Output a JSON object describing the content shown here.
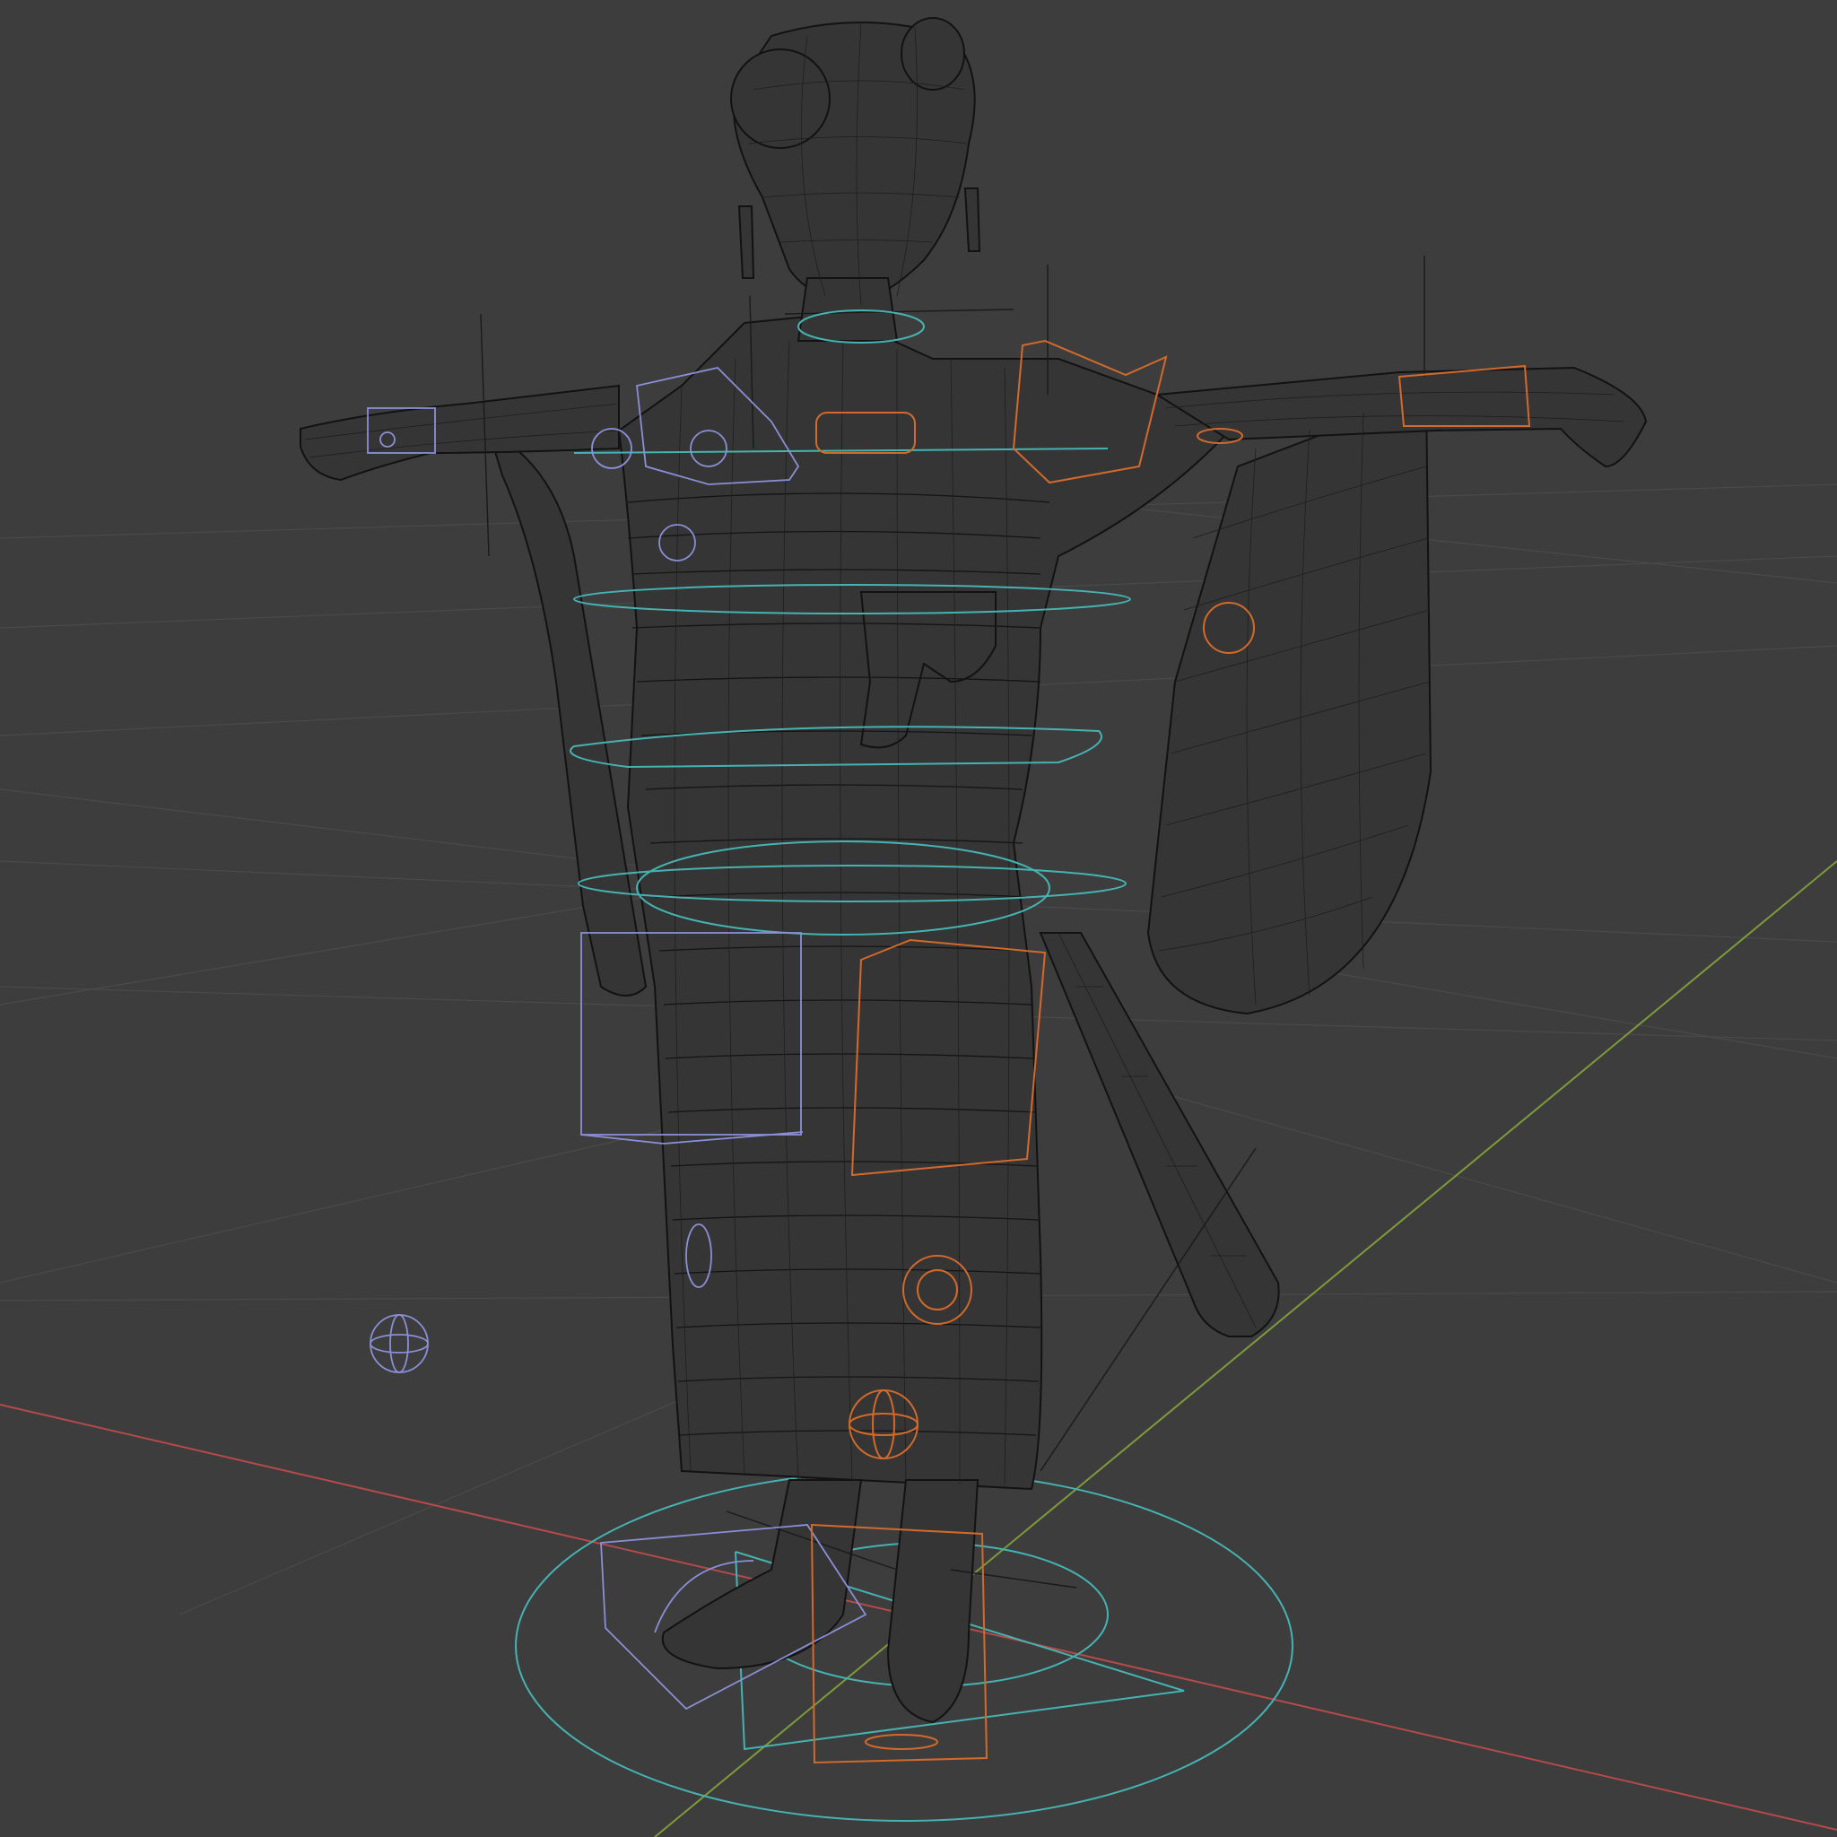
{
  "viewport": {
    "mode": "wireframe",
    "background_color": "#3d3d3d",
    "grid_color": "#4a4a4a",
    "axis_x_color": "#b54a4a",
    "axis_y_color": "#7f9a3a",
    "mesh_color": "#141414"
  },
  "rig": {
    "controller_colors": {
      "center": "#46b3b3",
      "left_side": "#8a8fd6",
      "right_side": "#d26a2b"
    }
  },
  "icons": {
    "empty": "empty-sphere-icon"
  }
}
